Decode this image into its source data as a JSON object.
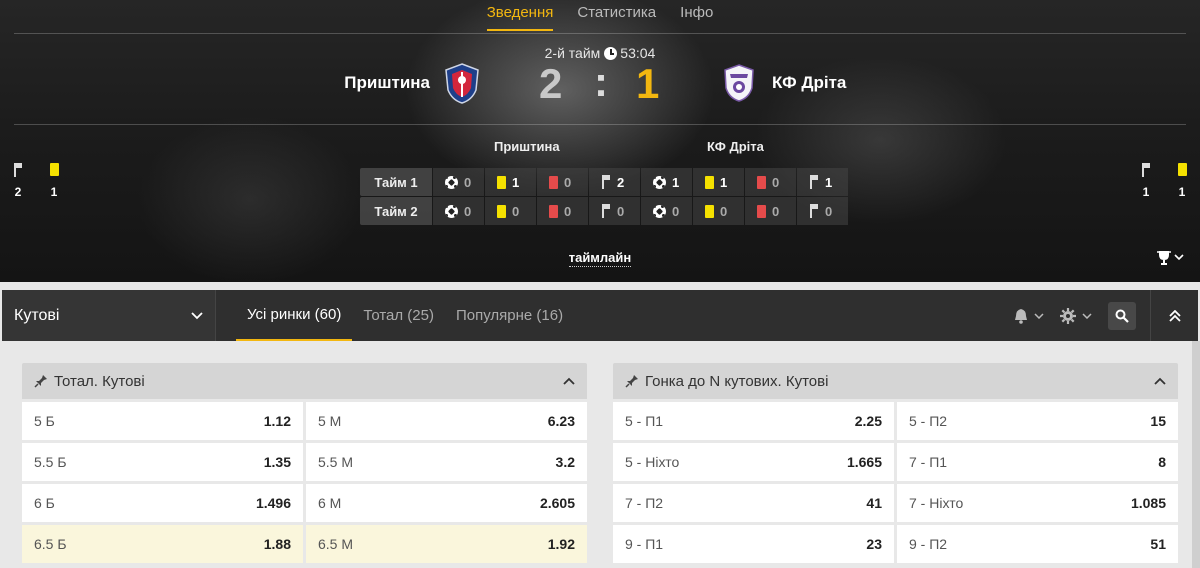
{
  "top_tabs": [
    {
      "label": "Зведення",
      "active": true
    },
    {
      "label": "Статистика",
      "active": false
    },
    {
      "label": "Інфо",
      "active": false
    }
  ],
  "match": {
    "period": "2-й тайм",
    "time": "53:04",
    "home": {
      "name": "Приштина",
      "score": "2"
    },
    "away": {
      "name": "КФ Дріта",
      "score": "1"
    },
    "separator": ":"
  },
  "side_stats": {
    "home": {
      "corners": "2",
      "yellow": "1"
    },
    "away": {
      "corners": "1",
      "yellow": "1"
    }
  },
  "period_table": {
    "home_label": "Приштина",
    "away_label": "КФ Дріта",
    "rows": [
      {
        "label": "Тайм 1",
        "home": {
          "goals": "0",
          "yellow": "1",
          "red": "0",
          "corners": "2"
        },
        "away": {
          "goals": "1",
          "yellow": "1",
          "red": "0",
          "corners": "1"
        }
      },
      {
        "label": "Тайм 2",
        "home": {
          "goals": "0",
          "yellow": "0",
          "red": "0",
          "corners": "0"
        },
        "away": {
          "goals": "0",
          "yellow": "0",
          "red": "0",
          "corners": "0"
        }
      }
    ]
  },
  "timeline_label": "таймлайн",
  "toolbar": {
    "selected_market": "Кутові",
    "tabs": [
      {
        "label": "Усі ринки (60)",
        "active": true
      },
      {
        "label": "Тотал (25)",
        "active": false
      },
      {
        "label": "Популярне (16)",
        "active": false
      }
    ]
  },
  "markets": [
    {
      "title": "Тотал. Кутові",
      "odds": [
        {
          "label": "5 Б",
          "value": "1.12"
        },
        {
          "label": "5 М",
          "value": "6.23"
        },
        {
          "label": "5.5 Б",
          "value": "1.35"
        },
        {
          "label": "5.5 М",
          "value": "3.2"
        },
        {
          "label": "6 Б",
          "value": "1.496"
        },
        {
          "label": "6 М",
          "value": "2.605"
        },
        {
          "label": "6.5 Б",
          "value": "1.88",
          "highlight": true
        },
        {
          "label": "6.5 М",
          "value": "1.92",
          "highlight": true
        }
      ]
    },
    {
      "title": "Гонка до N кутових. Кутові",
      "odds": [
        {
          "label": "5 - П1",
          "value": "2.25"
        },
        {
          "label": "5 - П2",
          "value": "15"
        },
        {
          "label": "5 - Ніхто",
          "value": "1.665"
        },
        {
          "label": "7 - П1",
          "value": "8"
        },
        {
          "label": "7 - П2",
          "value": "41"
        },
        {
          "label": "7 - Ніхто",
          "value": "1.085"
        },
        {
          "label": "9 - П1",
          "value": "23"
        },
        {
          "label": "9 - П2",
          "value": "51"
        }
      ]
    }
  ],
  "colors": {
    "accent": "#f3b710",
    "yellow_card": "#f5e100",
    "red_card": "#e54b4b",
    "highlight_row": "#faf6dc"
  }
}
